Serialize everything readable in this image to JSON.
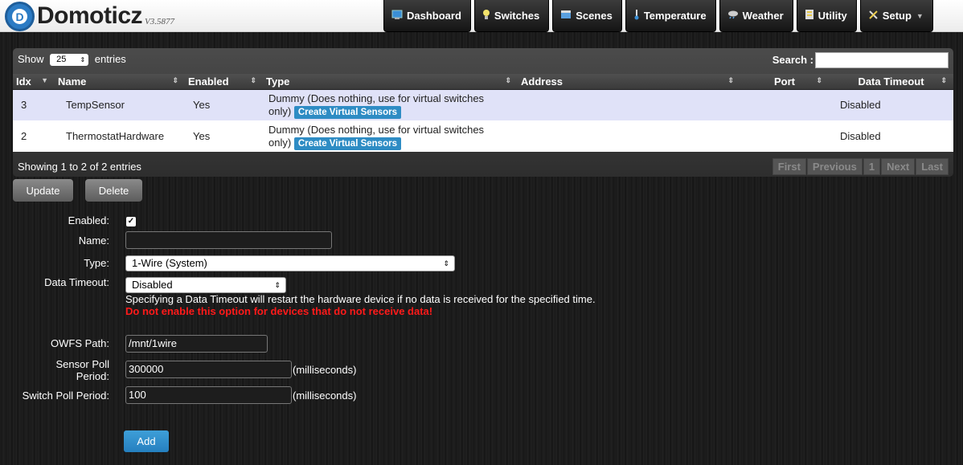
{
  "app": {
    "name": "Domoticz",
    "version": "V3.5877"
  },
  "nav": [
    {
      "label": "Dashboard",
      "icon": "dashboard-icon"
    },
    {
      "label": "Switches",
      "icon": "lightbulb-icon"
    },
    {
      "label": "Scenes",
      "icon": "scenes-icon"
    },
    {
      "label": "Temperature",
      "icon": "thermometer-icon"
    },
    {
      "label": "Weather",
      "icon": "weather-icon"
    },
    {
      "label": "Utility",
      "icon": "utility-icon"
    },
    {
      "label": "Setup",
      "icon": "tools-icon"
    }
  ],
  "table": {
    "show_label": "Show",
    "show_value": "25",
    "entries_label": "entries",
    "search_label": "Search :",
    "search_value": "",
    "columns": [
      "Idx",
      "Name",
      "Enabled",
      "Type",
      "Address",
      "Port",
      "Data Timeout"
    ],
    "rows": [
      {
        "idx": "3",
        "name": "TempSensor",
        "enabled": "Yes",
        "type": "Dummy (Does nothing, use for virtual switches",
        "type_cont": "only)",
        "button": "Create Virtual Sensors",
        "address": "",
        "port": "",
        "timeout": "Disabled"
      },
      {
        "idx": "2",
        "name": "ThermostatHardware",
        "enabled": "Yes",
        "type": "Dummy (Does nothing, use for virtual switches",
        "type_cont": "only)",
        "button": "Create Virtual Sensors",
        "address": "",
        "port": "",
        "timeout": "Disabled"
      }
    ],
    "info": "Showing 1 to 2 of 2 entries",
    "pager": [
      "First",
      "Previous",
      "1",
      "Next",
      "Last"
    ]
  },
  "actions": {
    "update": "Update",
    "delete": "Delete"
  },
  "form": {
    "enabled_label": "Enabled:",
    "enabled_checked": true,
    "name_label": "Name:",
    "name_value": "",
    "type_label": "Type:",
    "type_value": "1-Wire (System)",
    "timeout_label": "Data Timeout:",
    "timeout_value": "Disabled",
    "timeout_note": "Specifying a Data Timeout will restart the hardware device if no data is received for the specified time.",
    "timeout_warning": "Do not enable this option for devices that do not receive data!",
    "owfs_label": "OWFS Path:",
    "owfs_value": "/mnt/1wire",
    "sensor_poll_label_1": "Sensor Poll",
    "sensor_poll_label_2": "Period:",
    "sensor_poll_value": "300000",
    "switch_poll_label": "Switch Poll Period:",
    "switch_poll_value": "100",
    "unit": "(milliseconds)",
    "add_label": "Add"
  },
  "colors": {
    "accent": "#2e8cc4",
    "warning": "#ff1a1a",
    "selected_row": "#e0e2f8"
  }
}
